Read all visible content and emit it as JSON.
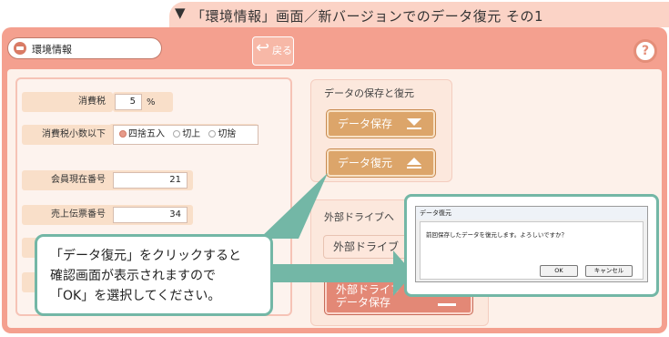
{
  "caption": {
    "arrow": "▼",
    "text": "「環境情報」画面／新バージョンでのデータ復元 その1"
  },
  "header": {
    "title": "環境情報",
    "back_label": "戻る",
    "help": "?"
  },
  "settings": {
    "tax_label": "消費税",
    "tax_value": "5",
    "tax_unit": "%",
    "rounding_label": "消費税小数以下",
    "rounding_options": [
      "四捨五入",
      "切上",
      "切捨"
    ],
    "rounding_selected": "四捨五入",
    "member_label": "会員現在番号",
    "member_value": "21",
    "slip_label": "売上伝票番号",
    "slip_value": "34"
  },
  "backup": {
    "title": "データの保存と復元",
    "save_label": "データ保存",
    "restore_label": "データ復元"
  },
  "external": {
    "title": "外部ドライブへ",
    "btn1_label": "外部ドライブ",
    "btn2_line1": "外部ドライブ",
    "btn2_line2": "データ保存"
  },
  "dialog": {
    "title": "データ復元",
    "message": "前回保存したデータを復元します。よろしいですか？",
    "ok_label": "OK",
    "cancel_label": "キャンセル"
  },
  "callout": {
    "line1": "「データ復元」をクリックすると",
    "line2": "確認画面が表示されますので",
    "line3": "「OK」を選択してください。"
  },
  "colors": {
    "frame": "#f4a08f",
    "accent_green": "#73b7a6",
    "button_tan": "#dca56a",
    "button_pink": "#e38876"
  }
}
